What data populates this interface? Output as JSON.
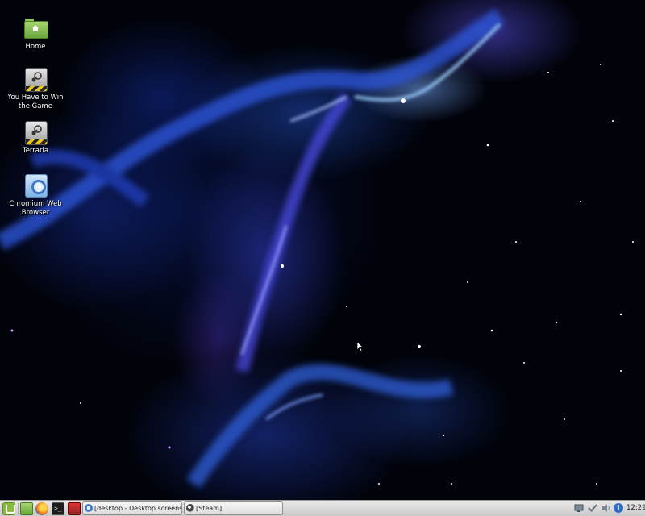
{
  "desktop": {
    "icons": [
      {
        "label": "Home",
        "icon": "home-folder-icon"
      },
      {
        "label": "You Have to Win the Game",
        "icon": "steam-game-icon"
      },
      {
        "label": "Terraria",
        "icon": "steam-game-icon"
      },
      {
        "label": "Chromium Web Browser",
        "icon": "chromium-icon"
      }
    ]
  },
  "taskbar": {
    "menu_icon": "mint-menu-icon",
    "quick_launch": [
      {
        "icon": "file-manager-icon"
      },
      {
        "icon": "firefox-icon"
      },
      {
        "icon": "terminal-icon",
        "glyph": ">_"
      },
      {
        "icon": "app-launcher-icon"
      }
    ],
    "tasks": [
      {
        "label": "[desktop - Desktop screens...",
        "icon": "chromium-icon"
      },
      {
        "label": "[Steam]",
        "icon": "steam-icon"
      }
    ],
    "tray": {
      "info_glyph": "i",
      "clock": "12:29"
    }
  },
  "colors": {
    "taskbar": "#d8d8d8",
    "mint_green": "#87bd3d",
    "wallpaper_accent": "#3c5cff"
  }
}
